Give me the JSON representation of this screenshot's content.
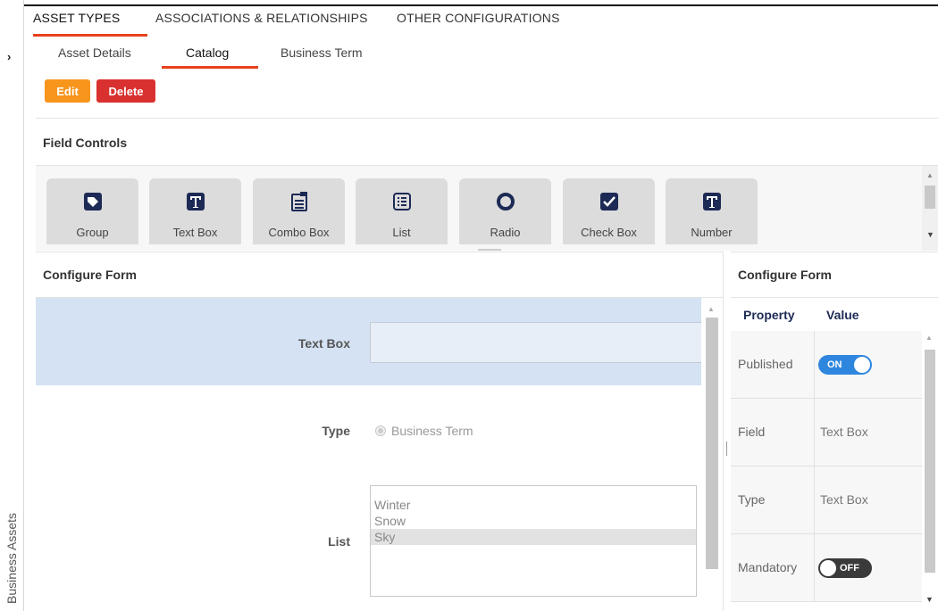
{
  "rail": {
    "label": "Business Assets",
    "expand_icon": "chevron-right-icon"
  },
  "top_tabs": [
    {
      "label": "ASSET TYPES",
      "active": true
    },
    {
      "label": "ASSOCIATIONS & RELATIONSHIPS",
      "active": false
    },
    {
      "label": "OTHER CONFIGURATIONS",
      "active": false
    }
  ],
  "sub_tabs": [
    {
      "label": "Asset Details",
      "active": false
    },
    {
      "label": "Catalog",
      "active": true
    },
    {
      "label": "Business Term",
      "active": false
    }
  ],
  "actions": {
    "edit_label": "Edit",
    "delete_label": "Delete",
    "edit_color": "#f7951d",
    "delete_color": "#d9312f"
  },
  "field_controls": {
    "title": "Field Controls",
    "items": [
      {
        "label": "Group",
        "icon": "tag-icon"
      },
      {
        "label": "Text Box",
        "icon": "text-box-icon"
      },
      {
        "label": "Combo Box",
        "icon": "combo-box-icon"
      },
      {
        "label": "List",
        "icon": "list-icon"
      },
      {
        "label": "Radio",
        "icon": "radio-icon"
      },
      {
        "label": "Check Box",
        "icon": "check-box-icon"
      },
      {
        "label": "Number",
        "icon": "number-icon"
      }
    ]
  },
  "configure_form": {
    "title": "Configure Form",
    "fields": {
      "text_box_label": "Text Box",
      "text_box_value": "",
      "type_label": "Type",
      "type_option": "Business Term",
      "list_label": "List",
      "list_options": [
        "Winter",
        "Snow",
        "Sky"
      ],
      "list_selected": "Sky"
    }
  },
  "properties": {
    "title": "Configure Form",
    "col_property": "Property",
    "col_value": "Value",
    "rows": [
      {
        "name": "Published",
        "toggle": "ON"
      },
      {
        "name": "Field",
        "value": "Text Box"
      },
      {
        "name": "Type",
        "value": "Text Box"
      },
      {
        "name": "Mandatory",
        "toggle": "OFF"
      }
    ]
  },
  "colors": {
    "accent": "#e8411c",
    "selected_row": "#d4e2f4",
    "toggle_on": "#2e86de",
    "toggle_off": "#3a3a3a"
  }
}
